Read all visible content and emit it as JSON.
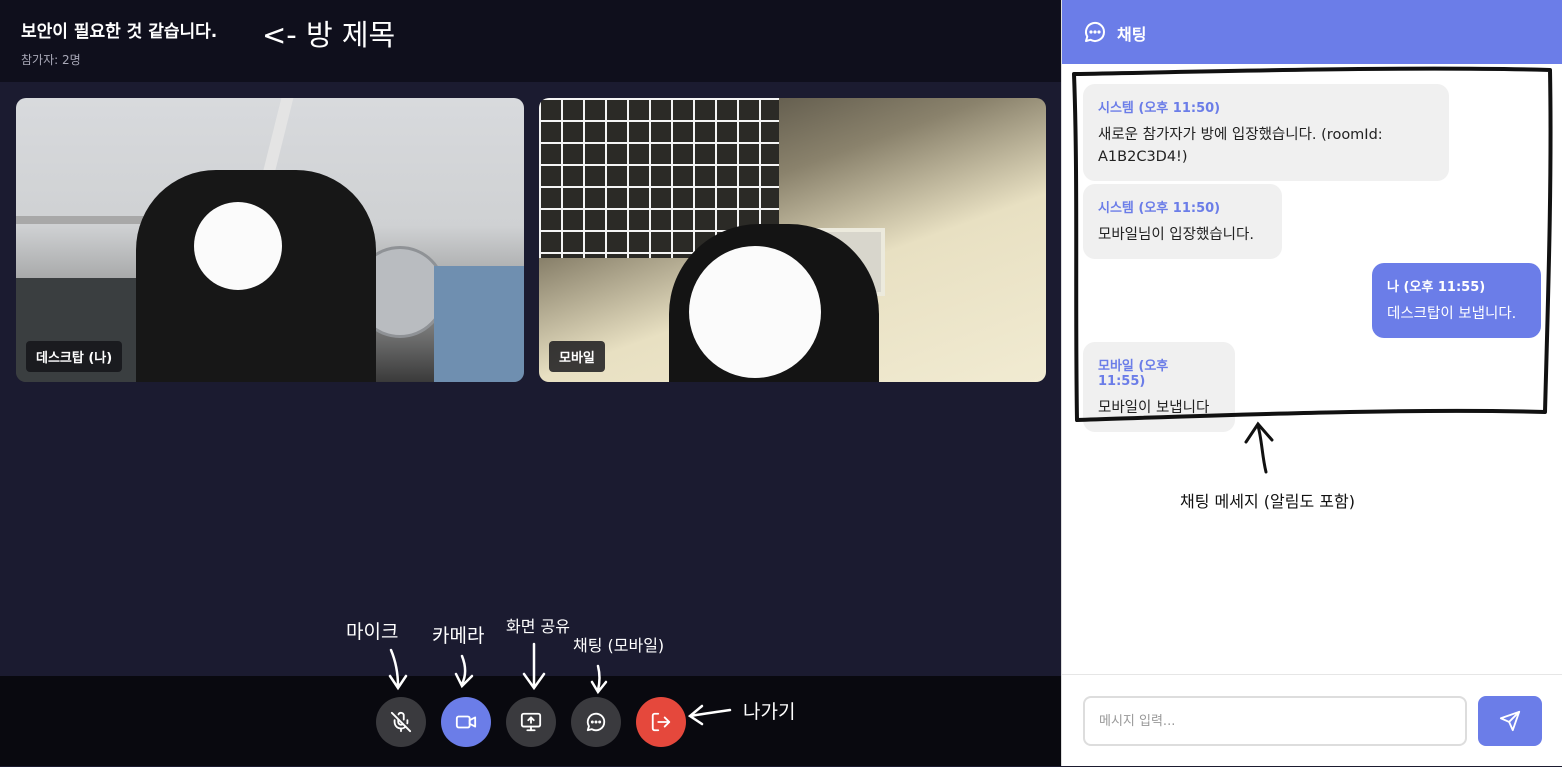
{
  "room": {
    "title": "보안이 필요한 것 같습니다.",
    "participants": "참가자: 2명"
  },
  "videos": [
    {
      "label": "데스크탑 (나)"
    },
    {
      "label": "모바일"
    }
  ],
  "controls": {
    "mic": {
      "icon": "mic-off-icon",
      "color": "#3a3a3e"
    },
    "camera": {
      "icon": "video-camera-icon",
      "color": "#6b7de8"
    },
    "screen_share": {
      "icon": "screen-share-icon",
      "color": "#3a3a3e"
    },
    "chat": {
      "icon": "chat-icon",
      "color": "#3a3a3e"
    },
    "leave": {
      "icon": "exit-icon",
      "color": "#e5483c"
    }
  },
  "chat": {
    "title": "채팅",
    "messages": [
      {
        "sender": "시스템 (오후 11:50)",
        "text": "새로운 참가자가 방에 입장했습니다. (roomId: A1B2C3D4!)",
        "mine": false
      },
      {
        "sender": "시스템 (오후 11:50)",
        "text": "모바일님이 입장했습니다.",
        "mine": false
      },
      {
        "sender": "나 (오후 11:55)",
        "text": "데스크탑이 보냅니다.",
        "mine": true
      },
      {
        "sender": "모바일 (오후 11:55)",
        "text": "모바일이 보냅니다",
        "mine": false
      }
    ],
    "input_placeholder": "메시지 입력..."
  },
  "annotations": {
    "room_title": "<- 방 제목",
    "mic": "마이크",
    "camera": "카메라",
    "screen_share": "화면 공유",
    "chat_mobile": "채팅 (모바일)",
    "leave": "나가기",
    "chat_messages": "채팅 메세지 (알림도 포함)"
  },
  "colors": {
    "accent": "#6b7de8",
    "danger": "#e5483c",
    "background": "#1b1b30"
  }
}
